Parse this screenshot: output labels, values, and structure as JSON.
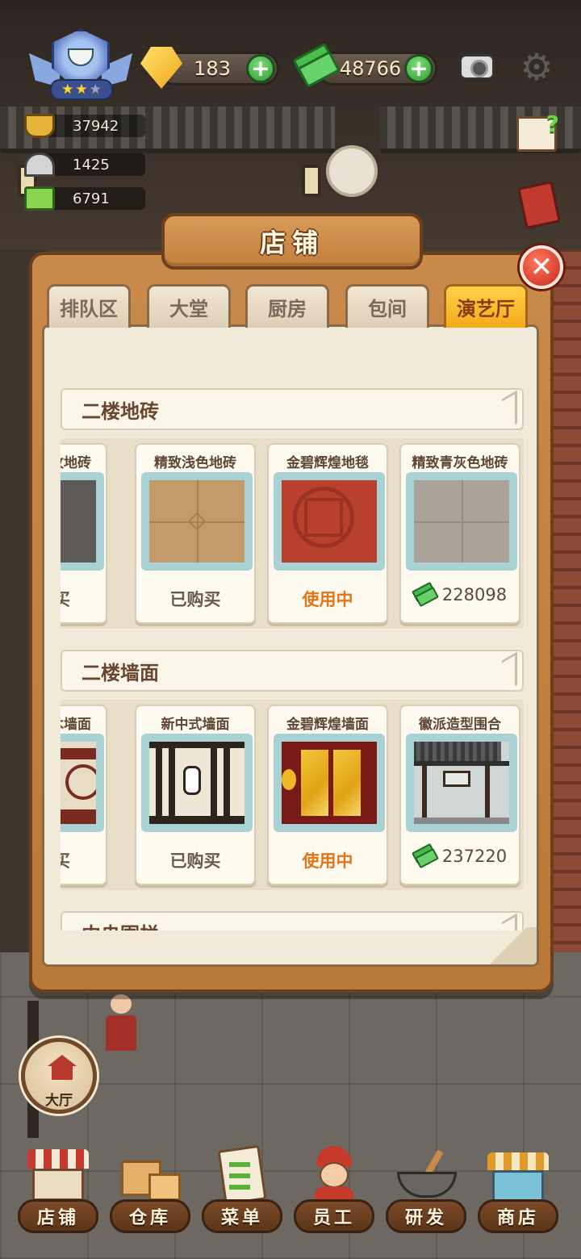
{
  "hud": {
    "rank_stars_filled": 2,
    "rank_stars_total": 3,
    "gems": "183",
    "cash": "48766",
    "stats": [
      {
        "icon": "hotpot-icon",
        "value": "37942"
      },
      {
        "icon": "cloche-icon",
        "value": "1425"
      },
      {
        "icon": "menu-card-icon",
        "value": "6791"
      }
    ]
  },
  "panel": {
    "title": "店铺",
    "tabs": [
      {
        "label": "排队区",
        "active": false
      },
      {
        "label": "大堂",
        "active": false
      },
      {
        "label": "厨房",
        "active": false
      },
      {
        "label": "包间",
        "active": false
      },
      {
        "label": "演艺厅",
        "active": true
      }
    ],
    "sections": [
      {
        "title": "二楼地砖",
        "items": [
          {
            "name": "纹地砖",
            "status": "购买",
            "kind": "status"
          },
          {
            "name": "精致浅色地砖",
            "status": "已购买",
            "kind": "status"
          },
          {
            "name": "金碧辉煌地毯",
            "status": "使用中",
            "kind": "in-use"
          },
          {
            "name": "精致青灰色地砖",
            "price": "228098",
            "kind": "price"
          }
        ]
      },
      {
        "title": "二楼墙面",
        "items": [
          {
            "name": "木墙面",
            "status": "购买",
            "kind": "status"
          },
          {
            "name": "新中式墙面",
            "status": "已购买",
            "kind": "status"
          },
          {
            "name": "金碧辉煌墙面",
            "status": "使用中",
            "kind": "in-use"
          },
          {
            "name": "徽派造型围合",
            "price": "237220",
            "kind": "price"
          }
        ]
      },
      {
        "title": "中央围栏"
      }
    ]
  },
  "hall_button": {
    "label": "大厅"
  },
  "bottom_nav": [
    {
      "label": "店铺",
      "icon": "shop-building-icon"
    },
    {
      "label": "仓库",
      "icon": "boxes-icon"
    },
    {
      "label": "菜单",
      "icon": "menu-checklist-icon"
    },
    {
      "label": "员工",
      "icon": "staff-chef-icon"
    },
    {
      "label": "研发",
      "icon": "wok-icon"
    },
    {
      "label": "商店",
      "icon": "store-icon"
    }
  ],
  "colors": {
    "active_tab": "#f3aa1a",
    "in_use": "#e0751a",
    "plus_button": "#2f9a31",
    "close_button": "#c8271b"
  }
}
